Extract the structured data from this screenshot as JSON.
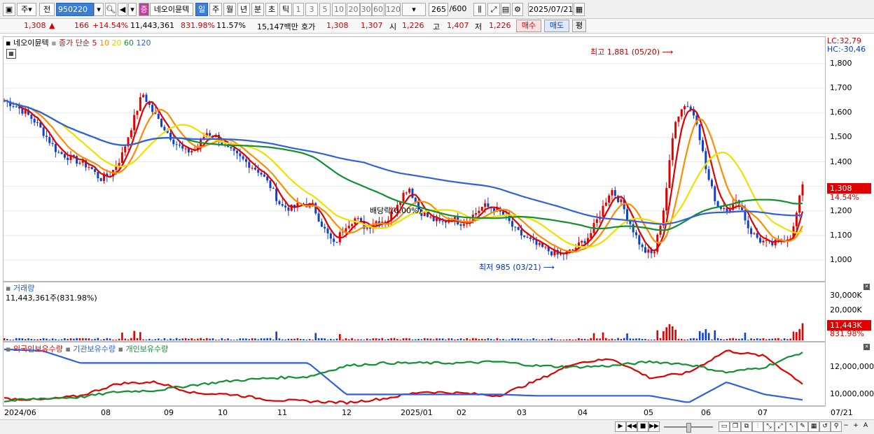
{
  "toolbar": {
    "period_sel": "주",
    "mode_sel": "전",
    "code": "950220",
    "badge": "증",
    "name": "네오이뮨텍",
    "tabs": [
      "일",
      "주",
      "월",
      "년",
      "분",
      "초",
      "틱"
    ],
    "intervals": [
      "1",
      "3",
      "5",
      "10",
      "20",
      "30",
      "60",
      "120"
    ],
    "count": "265",
    "total": "/600",
    "date": "2025/07/21"
  },
  "info": {
    "price": "1,308",
    "change": "166",
    "pct": "+14.54%",
    "volume": "11,443,361",
    "vol_ratio": "831.98%",
    "turnover": "11.57%",
    "amount": "15,147백만",
    "hoga_label": "호가",
    "ask": "1,308",
    "bid": "1,307",
    "open_label": "시",
    "open": "1,226",
    "high_label": "고",
    "high": "1,407",
    "low_label": "저",
    "low": "1,226",
    "buy": "매수",
    "sell": "매도",
    "eval": "평"
  },
  "price_panel": {
    "legend_name": "네오이뮨텍",
    "legend_main": "종가 단순",
    "ma_periods": [
      "5",
      "10",
      "20",
      "60",
      "120"
    ],
    "ma_colors": [
      "#e00000",
      "#ff8c00",
      "#f0e000",
      "#109030",
      "#3060e0"
    ],
    "lc": "LC:32,79",
    "hc": "HC:-30,46",
    "max_label": "최고 1,881 (05/20)",
    "min_label": "최저 985 (03/21)",
    "dividend_label": "배당락(0.00%)",
    "current_price": "1,308",
    "current_pct": "14.54%"
  },
  "volume_panel": {
    "title": "거래량",
    "value": "11,443,361주(831.98%)",
    "current": "11,443K",
    "current_pct": "831.98%"
  },
  "holdings_panel": {
    "series": [
      "외국인보유수량",
      "기관보유수량",
      "개인보유수량"
    ],
    "colors": [
      "#e00000",
      "#3060e0",
      "#109030"
    ]
  },
  "x_labels": [
    "2024/06",
    "08",
    "09",
    "10",
    "11",
    "12",
    "2025/01",
    "02",
    "03",
    "04",
    "05",
    "06",
    "07",
    "07/21"
  ],
  "chart_data": [
    {
      "type": "line",
      "title": "",
      "y_ticks": [
        1000,
        1100,
        1200,
        1300,
        1400,
        1500,
        1600,
        1700,
        1800
      ],
      "ylim": [
        920,
        1900
      ],
      "close_approx": [
        1650,
        1630,
        1600,
        1560,
        1500,
        1440,
        1420,
        1400,
        1380,
        1330,
        1350,
        1420,
        1550,
        1680,
        1600,
        1540,
        1480,
        1440,
        1450,
        1520,
        1500,
        1450,
        1420,
        1390,
        1360,
        1300,
        1220,
        1210,
        1230,
        1220,
        1130,
        1060,
        1140,
        1170,
        1130,
        1160,
        1160,
        1240,
        1300,
        1200,
        1170,
        1150,
        1170,
        1150,
        1180,
        1220,
        1210,
        1180,
        1120,
        1090,
        1060,
        1040,
        1020,
        1030,
        1060,
        1100,
        1190,
        1290,
        1230,
        1130,
        1040,
        1020,
        1220,
        1570,
        1640,
        1580,
        1350,
        1220,
        1210,
        1240,
        1120,
        1080,
        1060,
        1080,
        1100,
        1308
      ],
      "highlights": {
        "max": 1881,
        "max_date": "05/20",
        "min": 985,
        "min_date": "03/21",
        "last": 1308
      }
    },
    {
      "type": "bar",
      "title": "거래량",
      "y_ticks": [
        10000,
        20000,
        30000
      ],
      "y_unit": "K",
      "last": 11443
    },
    {
      "type": "line",
      "y_ticks": [
        10000000,
        12000000
      ],
      "series": [
        {
          "name": "외국인보유수량",
          "values": [
            9.7,
            9.6,
            9.9,
            10.8,
            10.9,
            10.1,
            10.0,
            9.6,
            9.5,
            9.4,
            9.7,
            10.2,
            10.1,
            9.9,
            11.0,
            12.3,
            12.6,
            11.2,
            11.6,
            13.2,
            12.8,
            10.8
          ]
        },
        {
          "name": "기관보유수량",
          "values": [
            13.3,
            13.2,
            12.3,
            12.3,
            12.3,
            12.3,
            12.3,
            12.3,
            12.3,
            10.0,
            10.0,
            10.0,
            10.0,
            10.0,
            9.9,
            9.9,
            9.9,
            9.9,
            9.4,
            10.9,
            10.0,
            9.6
          ]
        },
        {
          "name": "개인보유수량",
          "values": [
            9.5,
            9.7,
            9.8,
            10.2,
            10.3,
            10.7,
            11.0,
            11.2,
            11.3,
            12.1,
            12.3,
            12.3,
            12.3,
            12.4,
            12.1,
            12.0,
            12.1,
            12.4,
            12.2,
            11.6,
            12.0,
            13.1
          ]
        }
      ]
    }
  ]
}
